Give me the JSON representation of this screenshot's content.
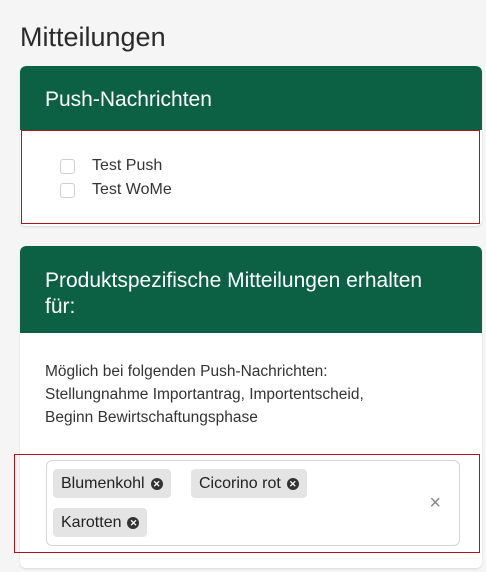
{
  "page": {
    "title": "Mitteilungen"
  },
  "push_section": {
    "header": "Push-Nachrichten",
    "options": [
      {
        "label": "Test Push",
        "checked": false
      },
      {
        "label": "Test WoMe",
        "checked": false
      }
    ]
  },
  "product_section": {
    "header": "Produktspezifische Mitteilungen erhalten für:",
    "info_lines": [
      "Möglich bei folgenden Push-Nachrichten:",
      "Stellungnahme Importantrag, Importentscheid,",
      "Beginn Bewirtschaftungsphase"
    ],
    "tags": [
      "Blumenkohl",
      "Cicorino rot",
      "Karotten"
    ],
    "clear_symbol": "×",
    "tag_remove_symbol": "✕"
  },
  "colors": {
    "header_bg": "#0c6145",
    "highlight": "#b0131a"
  },
  "icons": {
    "tag_remove": "close-circle-icon",
    "clear": "clear-x-icon"
  }
}
